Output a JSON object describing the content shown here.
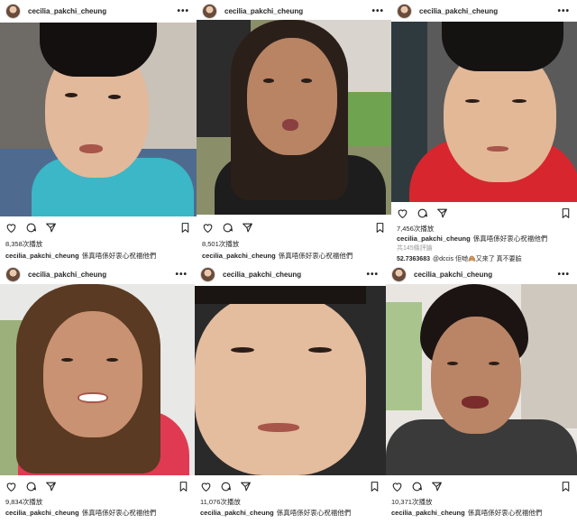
{
  "posts": [
    {
      "username": "cecilia_pakchi_cheung",
      "views": "8,358次播放",
      "caption_user": "cecilia_pakchi_cheung",
      "caption_text": "係真唔係好衷心祝福他們",
      "photo": "boy-green-shirt"
    },
    {
      "username": "cecilia_pakchi_cheung",
      "views": "8,501次播放",
      "caption_user": "cecilia_pakchi_cheung",
      "caption_text": "係真唔係好衷心祝福他們",
      "photo": "woman-pout"
    },
    {
      "username": "cecilia_pakchi_cheung",
      "views": "7,456次播放",
      "caption_user": "cecilia_pakchi_cheung",
      "caption_text": "係真唔係好衷心祝福他們",
      "comments_count": "共145條評論",
      "comment_user": "52.7363683",
      "comment_text": "@dccis 佢哋🙈又來了 真不要臉",
      "photo": "boy-red-shirt"
    },
    {
      "username": "cecilia_pakchi_cheung",
      "views": "9,834次播放",
      "caption_user": "cecilia_pakchi_cheung",
      "caption_text": "係真唔係好衷心祝福他們",
      "photo": "woman-smile-red"
    },
    {
      "username": "cecilia_pakchi_cheung",
      "views": "11,076次播放",
      "caption_user": "cecilia_pakchi_cheung",
      "caption_text": "係真唔係好衷心祝福他們",
      "photo": "boy-closeup"
    },
    {
      "username": "cecilia_pakchi_cheung",
      "views": "10,371次播放",
      "caption_user": "cecilia_pakchi_cheung",
      "caption_text": "係真唔係好衷心祝福他們",
      "photo": "woman-talking"
    }
  ],
  "icons": {
    "like": "heart-icon",
    "comment": "comment-icon",
    "share": "share-icon",
    "save": "bookmark-icon",
    "more": "more-options-icon"
  }
}
